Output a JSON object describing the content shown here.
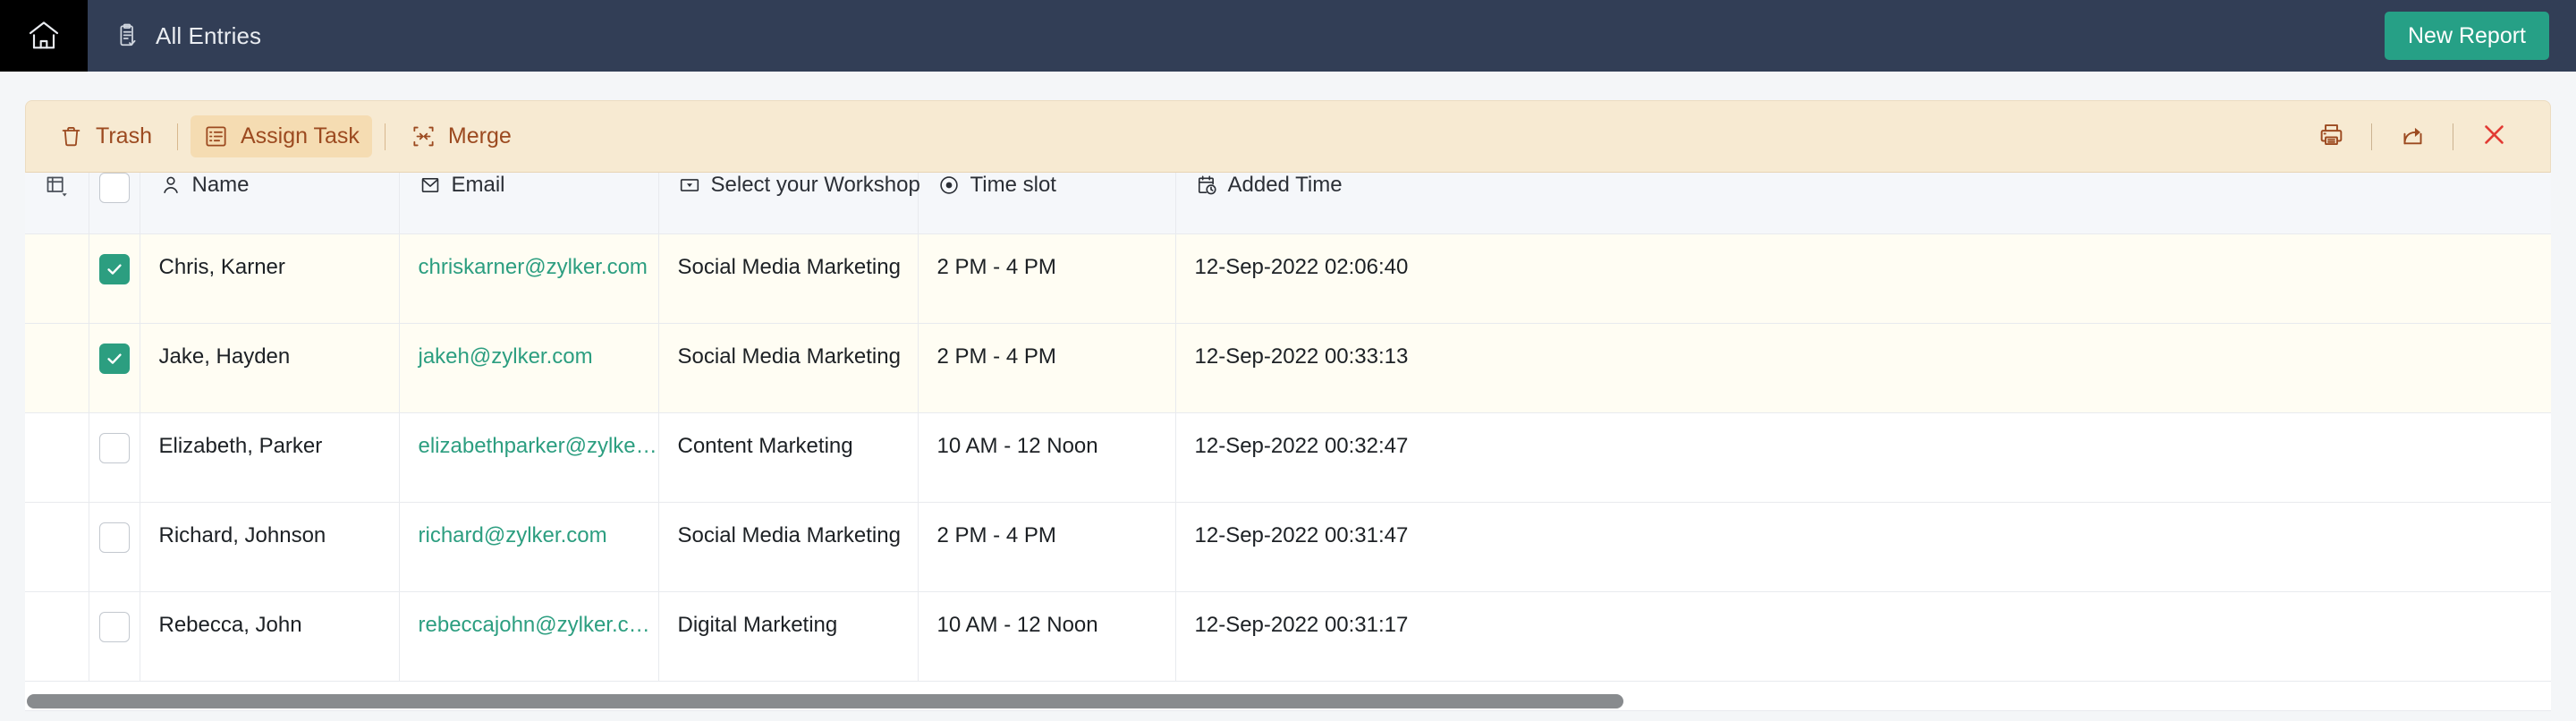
{
  "topbar": {
    "home_icon": "home-icon",
    "breadcrumb_icon": "clipboard-check-icon",
    "breadcrumb_label": "All Entries",
    "new_report_label": "New Report",
    "bg_color": "#323e56",
    "home_tile_color": "#000000",
    "accent_color": "#26a086"
  },
  "toolbar": {
    "bg_color": "#f7ead2",
    "text_color": "#9c4a20",
    "active_bg_color": "#f5dcb2",
    "actions": [
      {
        "label": "Trash",
        "icon": "trash-icon",
        "active": false
      },
      {
        "label": "Assign Task",
        "icon": "assign-task-icon",
        "active": true
      },
      {
        "label": "Merge",
        "icon": "merge-icon",
        "active": false
      }
    ],
    "right_icons": [
      {
        "name": "print-icon"
      },
      {
        "name": "share-icon"
      },
      {
        "name": "close-icon",
        "color": "#e23b34"
      }
    ]
  },
  "table": {
    "columns": [
      {
        "key": "options",
        "label": "",
        "icon": "column-settings-icon"
      },
      {
        "key": "select",
        "label": "",
        "icon": "checkbox-header"
      },
      {
        "key": "name",
        "label": "Name",
        "icon": "person-icon"
      },
      {
        "key": "email",
        "label": "Email",
        "icon": "envelope-icon"
      },
      {
        "key": "workshop",
        "label": "Select your Workshop",
        "icon": "dropdown-icon"
      },
      {
        "key": "timeslot",
        "label": "Time slot",
        "icon": "radio-icon"
      },
      {
        "key": "added_time",
        "label": "Added Time",
        "icon": "calendar-clock-icon"
      }
    ],
    "header_select_all_checked": false,
    "rows": [
      {
        "checked": true,
        "name": "Chris, Karner",
        "email": "chriskarner@zylker.com",
        "workshop": "Social Media Marketing",
        "timeslot": "2 PM - 4 PM",
        "added_time": "12-Sep-2022 02:06:40"
      },
      {
        "checked": true,
        "name": "Jake, Hayden",
        "email": "jakeh@zylker.com",
        "workshop": "Social Media Marketing",
        "timeslot": "2 PM - 4 PM",
        "added_time": "12-Sep-2022 00:33:13"
      },
      {
        "checked": false,
        "name": "Elizabeth, Parker",
        "email": "elizabethparker@zylker.com",
        "workshop": "Content Marketing",
        "timeslot": "10 AM - 12 Noon",
        "added_time": "12-Sep-2022 00:32:47"
      },
      {
        "checked": false,
        "name": "Richard, Johnson",
        "email": "richard@zylker.com",
        "workshop": "Social Media Marketing",
        "timeslot": "2 PM - 4 PM",
        "added_time": "12-Sep-2022 00:31:47"
      },
      {
        "checked": false,
        "name": "Rebecca, John",
        "email": "rebeccajohn@zylker.com",
        "workshop": "Digital Marketing",
        "timeslot": "10 AM - 12 Noon",
        "added_time": "12-Sep-2022 00:31:17"
      }
    ],
    "email_link_color": "#2c9e80",
    "selected_row_color": "#fffdf3"
  },
  "scrollbar": {
    "orientation": "horizontal",
    "thumb_color": "#888b8e"
  }
}
